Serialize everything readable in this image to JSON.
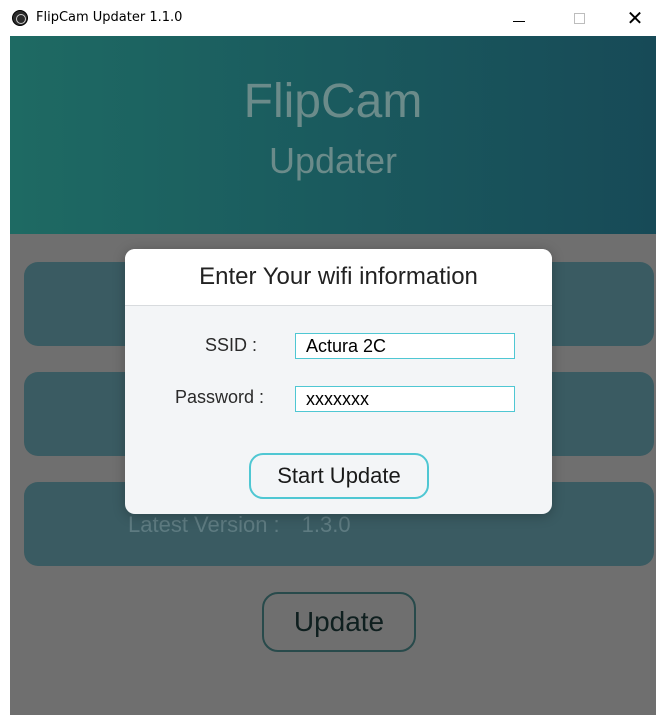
{
  "window": {
    "title": "FlipCam Updater 1.1.0",
    "app_icon": "flipcam-logo-icon",
    "controls": {
      "minimize": "minimize-icon",
      "maximize": "maximize-icon",
      "close": "close-icon",
      "close_glyph": "✕"
    }
  },
  "header": {
    "title": "FlipCam",
    "subtitle": "Updater"
  },
  "info": {
    "latest_label": "Latest Version :",
    "latest_value": "1.3.0"
  },
  "actions": {
    "update_label": "Update"
  },
  "modal": {
    "title": "Enter Your wifi information",
    "ssid_label": "SSID :",
    "ssid_value": "Actura 2C",
    "password_label": "Password :",
    "password_value": "xxxxxxx",
    "start_label": "Start Update"
  },
  "colors": {
    "header_gradient_start": "#1e6a63",
    "header_gradient_end": "#174a57",
    "accent_cyan": "#4fc7d3",
    "overlay_gray": "#6f6f6f"
  }
}
